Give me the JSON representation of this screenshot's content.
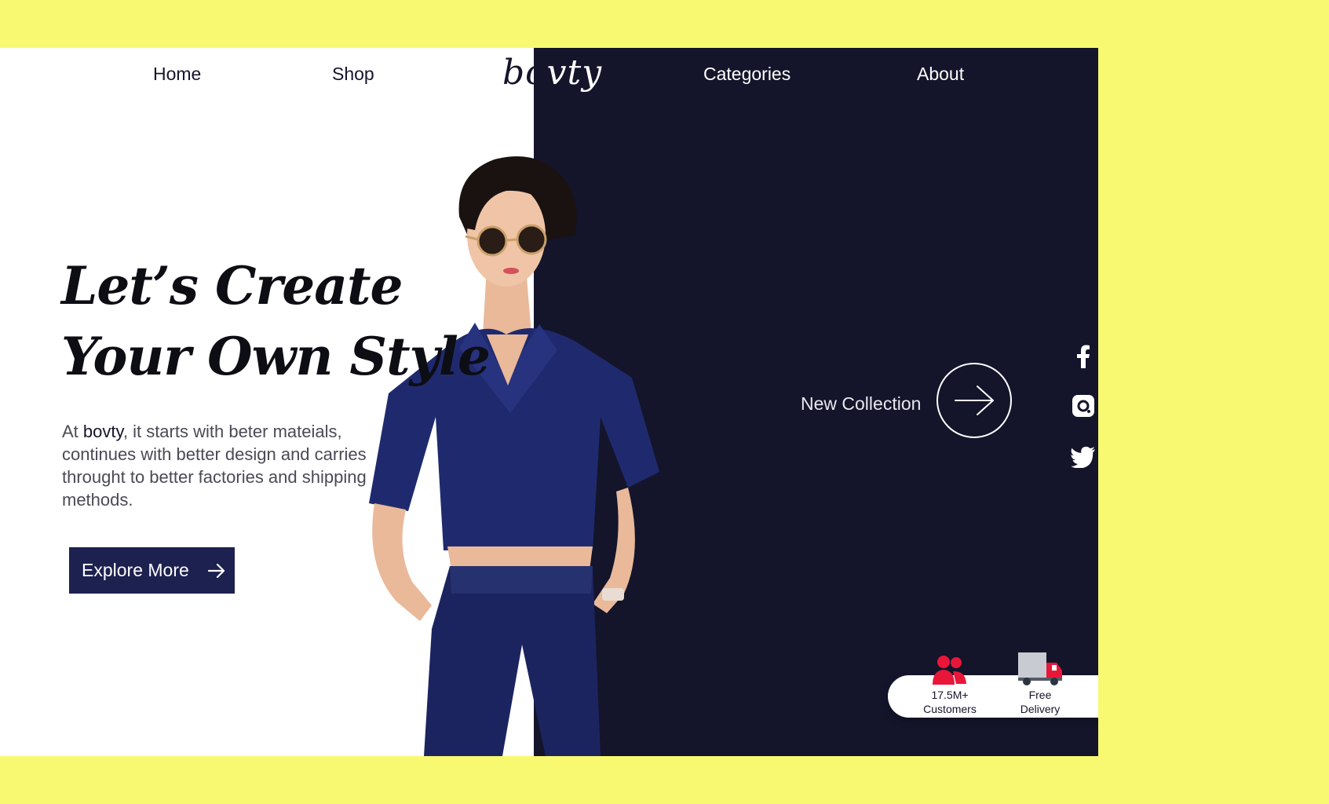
{
  "nav": {
    "home": "Home",
    "shop": "Shop",
    "categories": "Categories",
    "about": "About"
  },
  "logo": {
    "part1": "bo",
    "part2": "vty"
  },
  "hero": {
    "headline_line1": "Let’s Create",
    "headline_line2": "Your Own Style",
    "desc_prefix": "At ",
    "desc_brand": "bovty",
    "desc_rest": ", it starts with beter mateials, continues with better design and carries throught to better factories and shipping methods.",
    "explore_label": "Explore More"
  },
  "collection": {
    "label": "New Collection"
  },
  "social": [
    "facebook-icon",
    "instagram-icon",
    "twitter-icon"
  ],
  "stats": {
    "customers_value": "17.5M+",
    "customers_label": "Customers",
    "delivery_line1": "Free",
    "delivery_line2": "Delivery"
  },
  "colors": {
    "background": "#f9f871",
    "navy": "#14152b",
    "button": "#1d2150",
    "accent_red": "#e8173a"
  }
}
